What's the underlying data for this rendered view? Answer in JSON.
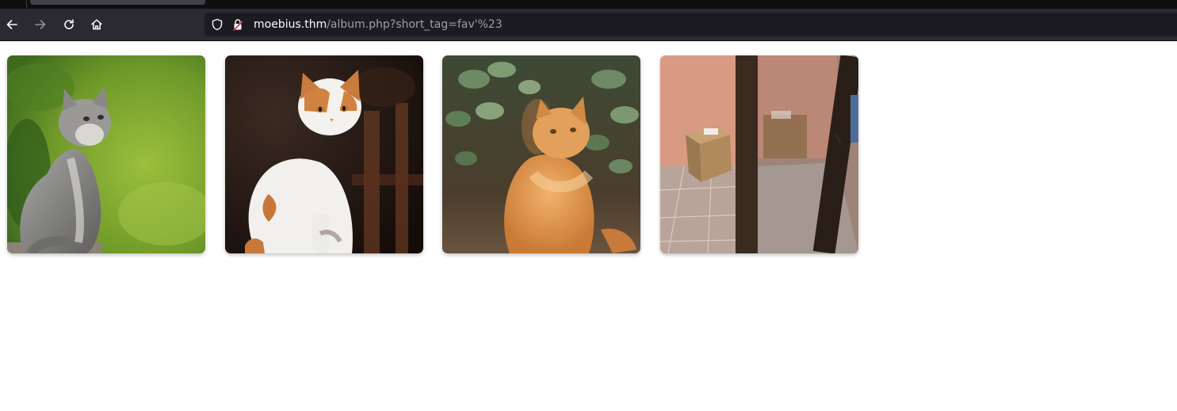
{
  "browser": {
    "tab": {
      "state": "active"
    },
    "nav": {
      "back_icon": "arrow-left-icon",
      "forward_icon": "arrow-right-icon",
      "reload_icon": "reload-icon",
      "home_icon": "home-icon"
    },
    "address_bar": {
      "host": "moebius.thm",
      "path": "/album.php?short_tag=fav'%23",
      "shield_icon": "shield-icon",
      "lock_icon": "insecure-lock-icon"
    },
    "colors": {
      "toolbar": "#2b2a33",
      "urlbar": "#1c1b22",
      "tabstrip": "#0f0f12",
      "insecure_lock": "#e22850"
    }
  },
  "album": {
    "photos": [
      {
        "subject": "grey kitten looking up against green background"
      },
      {
        "subject": "white and orange cat sitting in dark room"
      },
      {
        "subject": "fluffy orange cat in front of leaves"
      },
      {
        "subject": "cardboard box on tiled floor beside glass door"
      }
    ]
  }
}
